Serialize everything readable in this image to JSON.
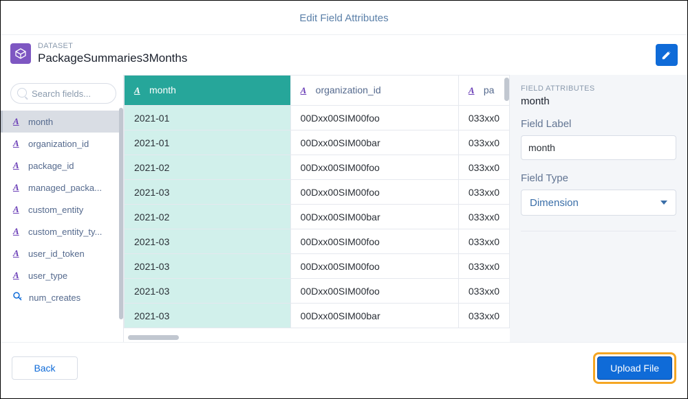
{
  "header": {
    "title": "Edit Field Attributes"
  },
  "dataset": {
    "label": "DATASET",
    "name": "PackageSummaries3Months"
  },
  "search": {
    "placeholder": "Search fields..."
  },
  "fields": [
    {
      "name": "month",
      "type": "dimension",
      "selected": true
    },
    {
      "name": "organization_id",
      "type": "dimension"
    },
    {
      "name": "package_id",
      "type": "dimension"
    },
    {
      "name": "managed_packa...",
      "type": "dimension"
    },
    {
      "name": "custom_entity",
      "type": "dimension"
    },
    {
      "name": "custom_entity_ty...",
      "type": "dimension"
    },
    {
      "name": "user_id_token",
      "type": "dimension"
    },
    {
      "name": "user_type",
      "type": "dimension"
    },
    {
      "name": "num_creates",
      "type": "measure"
    }
  ],
  "table": {
    "columns": [
      {
        "key": "month",
        "label": "month",
        "selected": true
      },
      {
        "key": "organization_id",
        "label": "organization_id"
      },
      {
        "key": "package_id",
        "label": "pa"
      }
    ],
    "rows": [
      {
        "month": "2021-01",
        "organization_id": "00Dxx00SIM00foo",
        "package_id": "033xx0"
      },
      {
        "month": "2021-01",
        "organization_id": "00Dxx00SIM00bar",
        "package_id": "033xx0"
      },
      {
        "month": "2021-02",
        "organization_id": "00Dxx00SIM00foo",
        "package_id": "033xx0"
      },
      {
        "month": "2021-03",
        "organization_id": "00Dxx00SIM00foo",
        "package_id": "033xx0"
      },
      {
        "month": "2021-02",
        "organization_id": "00Dxx00SIM00bar",
        "package_id": "033xx0"
      },
      {
        "month": "2021-03",
        "organization_id": "00Dxx00SIM00foo",
        "package_id": "033xx0"
      },
      {
        "month": "2021-03",
        "organization_id": "00Dxx00SIM00foo",
        "package_id": "033xx0"
      },
      {
        "month": "2021-03",
        "organization_id": "00Dxx00SIM00foo",
        "package_id": "033xx0"
      },
      {
        "month": "2021-03",
        "organization_id": "00Dxx00SIM00bar",
        "package_id": "033xx0"
      }
    ]
  },
  "attributes": {
    "section": "FIELD ATTRIBUTES",
    "fieldName": "month",
    "labelLabel": "Field Label",
    "labelValue": "month",
    "typeLabel": "Field Type",
    "typeValue": "Dimension"
  },
  "footer": {
    "back": "Back",
    "upload": "Upload File"
  }
}
